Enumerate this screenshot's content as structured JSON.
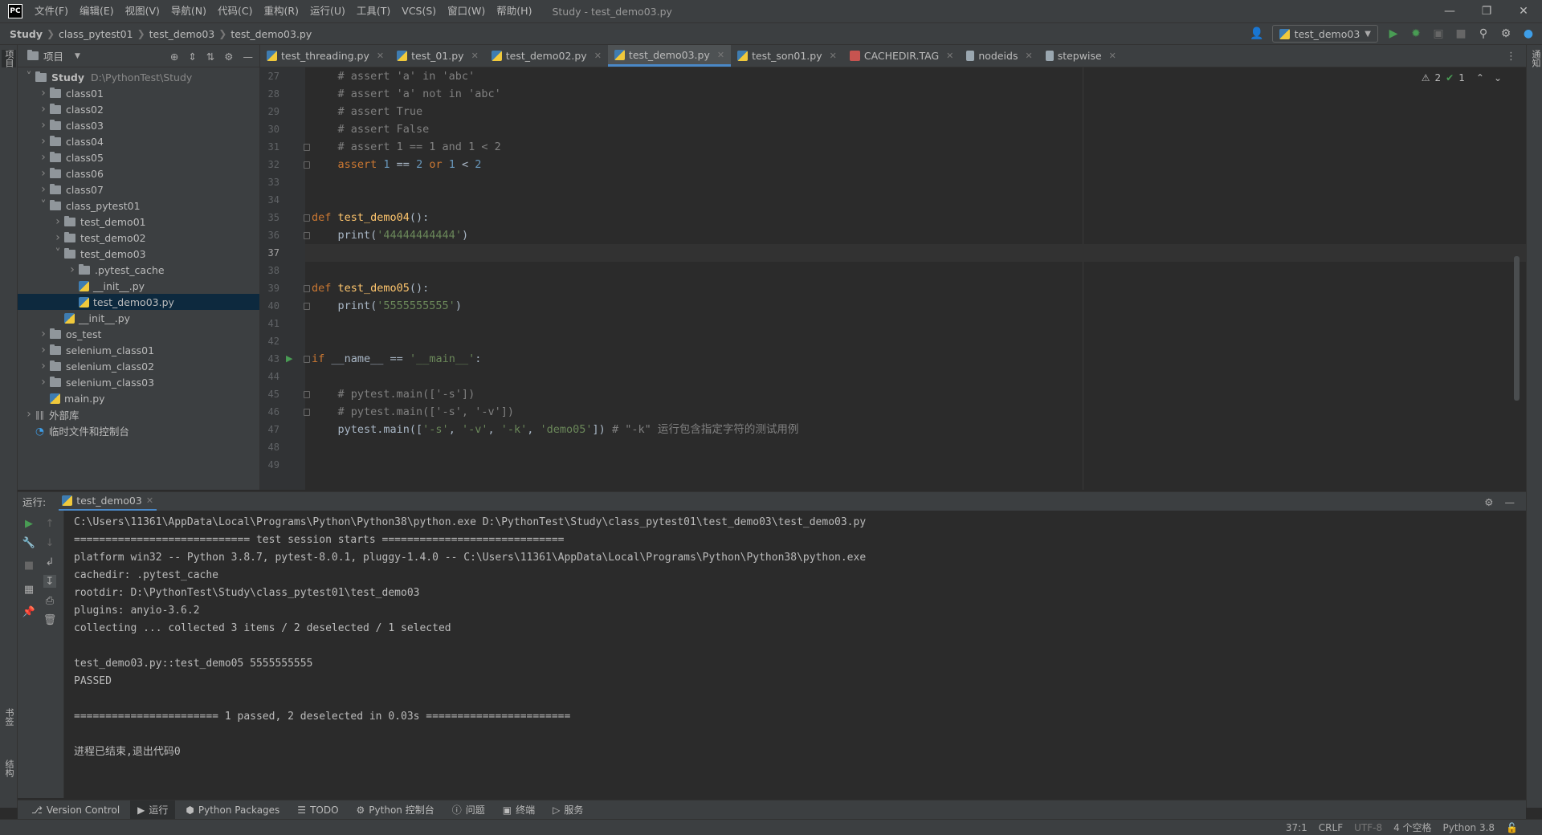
{
  "app": {
    "logo": "PC",
    "window_title": "Study - test_demo03.py",
    "menu": [
      "文件(F)",
      "编辑(E)",
      "视图(V)",
      "导航(N)",
      "代码(C)",
      "重构(R)",
      "运行(U)",
      "工具(T)",
      "VCS(S)",
      "窗口(W)",
      "帮助(H)"
    ]
  },
  "breadcrumb": [
    "Study",
    "class_pytest01",
    "test_demo03",
    "test_demo03.py"
  ],
  "toolbar": {
    "run_config": "test_demo03"
  },
  "left_strip": {
    "project_tab": "项目",
    "bookmarks_tab": "书签",
    "structure_tab": "结构"
  },
  "right_strip": {
    "notifications_tab": "通知"
  },
  "project_panel": {
    "title": "项目",
    "tree": [
      {
        "label": "Study",
        "hint": "D:\\PythonTest\\Study",
        "indent": 0,
        "expanded": true,
        "kind": "folder",
        "bold": true
      },
      {
        "label": "class01",
        "indent": 1,
        "expanded": false,
        "kind": "folder"
      },
      {
        "label": "class02",
        "indent": 1,
        "expanded": false,
        "kind": "folder"
      },
      {
        "label": "class03",
        "indent": 1,
        "expanded": false,
        "kind": "folder"
      },
      {
        "label": "class04",
        "indent": 1,
        "expanded": false,
        "kind": "folder"
      },
      {
        "label": "class05",
        "indent": 1,
        "expanded": false,
        "kind": "folder"
      },
      {
        "label": "class06",
        "indent": 1,
        "expanded": false,
        "kind": "folder"
      },
      {
        "label": "class07",
        "indent": 1,
        "expanded": false,
        "kind": "folder"
      },
      {
        "label": "class_pytest01",
        "indent": 1,
        "expanded": true,
        "kind": "folder"
      },
      {
        "label": "test_demo01",
        "indent": 2,
        "expanded": false,
        "kind": "folder"
      },
      {
        "label": "test_demo02",
        "indent": 2,
        "expanded": false,
        "kind": "folder"
      },
      {
        "label": "test_demo03",
        "indent": 2,
        "expanded": true,
        "kind": "folder"
      },
      {
        "label": ".pytest_cache",
        "indent": 3,
        "expanded": false,
        "kind": "folder"
      },
      {
        "label": "__init__.py",
        "indent": 3,
        "kind": "py"
      },
      {
        "label": "test_demo03.py",
        "indent": 3,
        "kind": "py",
        "selected": true
      },
      {
        "label": "__init__.py",
        "indent": 2,
        "kind": "py"
      },
      {
        "label": "os_test",
        "indent": 1,
        "expanded": false,
        "kind": "folder"
      },
      {
        "label": "selenium_class01",
        "indent": 1,
        "expanded": false,
        "kind": "folder"
      },
      {
        "label": "selenium_class02",
        "indent": 1,
        "expanded": false,
        "kind": "folder"
      },
      {
        "label": "selenium_class03",
        "indent": 1,
        "expanded": false,
        "kind": "folder"
      },
      {
        "label": "main.py",
        "indent": 1,
        "kind": "py"
      },
      {
        "label": "外部库",
        "indent": 0,
        "expanded": false,
        "kind": "lib"
      },
      {
        "label": "临时文件和控制台",
        "indent": 0,
        "kind": "scratch"
      }
    ]
  },
  "editor_tabs": [
    {
      "label": "test_threading.py",
      "icon": "py"
    },
    {
      "label": "test_01.py",
      "icon": "py"
    },
    {
      "label": "test_demo02.py",
      "icon": "py"
    },
    {
      "label": "test_demo03.py",
      "icon": "py",
      "active": true
    },
    {
      "label": "test_son01.py",
      "icon": "py"
    },
    {
      "label": "CACHEDIR.TAG",
      "icon": "tag"
    },
    {
      "label": "nodeids",
      "icon": "doc"
    },
    {
      "label": "stepwise",
      "icon": "doc"
    }
  ],
  "editor": {
    "warnings": "2",
    "checks": "1",
    "current_line": 37,
    "lines": [
      {
        "no": "27",
        "tokens": [
          [
            "cmt",
            "    # assert 'a' in 'abc'"
          ]
        ]
      },
      {
        "no": "28",
        "tokens": [
          [
            "cmt",
            "    # assert 'a' not in 'abc'"
          ]
        ]
      },
      {
        "no": "29",
        "tokens": [
          [
            "cmt",
            "    # assert True"
          ]
        ]
      },
      {
        "no": "30",
        "tokens": [
          [
            "cmt",
            "    # assert False"
          ]
        ]
      },
      {
        "no": "31",
        "tokens": [
          [
            "cmt",
            "    # assert 1 == 1 and 1 < 2"
          ]
        ],
        "fold": true
      },
      {
        "no": "32",
        "tokens": [
          [
            "kw",
            "    assert "
          ],
          [
            "num",
            "1"
          ],
          [
            "",
            " == "
          ],
          [
            "num",
            "2"
          ],
          [
            "kw",
            " or "
          ],
          [
            "num",
            "1"
          ],
          [
            "",
            " < "
          ],
          [
            "num",
            "2"
          ]
        ],
        "fold": true
      },
      {
        "no": "33",
        "tokens": []
      },
      {
        "no": "34",
        "tokens": []
      },
      {
        "no": "35",
        "tokens": [
          [
            "kw",
            "def "
          ],
          [
            "fn",
            "test_demo04"
          ],
          [
            "",
            "():"
          ]
        ],
        "fold": true
      },
      {
        "no": "36",
        "tokens": [
          [
            "",
            "    print("
          ],
          [
            "str",
            "'44444444444'"
          ],
          [
            "",
            ")"
          ]
        ],
        "fold": true
      },
      {
        "no": "37",
        "tokens": []
      },
      {
        "no": "38",
        "tokens": []
      },
      {
        "no": "39",
        "tokens": [
          [
            "kw",
            "def "
          ],
          [
            "fn",
            "test_demo05"
          ],
          [
            "",
            "():"
          ]
        ],
        "fold": true
      },
      {
        "no": "40",
        "tokens": [
          [
            "",
            "    print("
          ],
          [
            "str",
            "'5555555555'"
          ],
          [
            "",
            ")"
          ]
        ],
        "fold": true
      },
      {
        "no": "41",
        "tokens": []
      },
      {
        "no": "42",
        "tokens": []
      },
      {
        "no": "43",
        "tokens": [
          [
            "kw",
            "if "
          ],
          [
            "",
            "__name__ == "
          ],
          [
            "str",
            "'__main__'"
          ],
          [
            "",
            ":"
          ]
        ],
        "fold": true,
        "run": true
      },
      {
        "no": "44",
        "tokens": []
      },
      {
        "no": "45",
        "tokens": [
          [
            "cmt",
            "    # pytest.main(['-s'])"
          ]
        ],
        "fold": true
      },
      {
        "no": "46",
        "tokens": [
          [
            "cmt",
            "    # pytest.main(['-s', '-v'])"
          ]
        ],
        "fold": true
      },
      {
        "no": "47",
        "tokens": [
          [
            "",
            "    pytest.main(["
          ],
          [
            "str",
            "'-s'"
          ],
          [
            "",
            ", "
          ],
          [
            "str",
            "'-v'"
          ],
          [
            "",
            ", "
          ],
          [
            "str",
            "'-k'"
          ],
          [
            "",
            ", "
          ],
          [
            "str",
            "'demo05'"
          ],
          [
            "",
            "]) "
          ],
          [
            "cmt",
            "# \"-k\" 运行包含指定字符的测试用例"
          ]
        ]
      },
      {
        "no": "48",
        "tokens": []
      },
      {
        "no": "49",
        "tokens": []
      }
    ]
  },
  "run_panel": {
    "label": "运行:",
    "tab": "test_demo03",
    "console": [
      "C:\\Users\\11361\\AppData\\Local\\Programs\\Python\\Python38\\python.exe D:\\PythonTest\\Study\\class_pytest01\\test_demo03\\test_demo03.py",
      "============================ test session starts =============================",
      "platform win32 -- Python 3.8.7, pytest-8.0.1, pluggy-1.4.0 -- C:\\Users\\11361\\AppData\\Local\\Programs\\Python\\Python38\\python.exe",
      "cachedir: .pytest_cache",
      "rootdir: D:\\PythonTest\\Study\\class_pytest01\\test_demo03",
      "plugins: anyio-3.6.2",
      "collecting ... collected 3 items / 2 deselected / 1 selected",
      "",
      "test_demo03.py::test_demo05 5555555555",
      "PASSED",
      "",
      "======================= 1 passed, 2 deselected in 0.03s =======================",
      "",
      "进程已结束,退出代码0"
    ]
  },
  "bottom_tools": [
    {
      "label": "Version Control",
      "icon": "branch-icon"
    },
    {
      "label": "运行",
      "icon": "play-icon",
      "active": true
    },
    {
      "label": "Python Packages",
      "icon": "package-icon"
    },
    {
      "label": "TODO",
      "icon": "list-icon"
    },
    {
      "label": "Python 控制台",
      "icon": "python-console-icon"
    },
    {
      "label": "问题",
      "icon": "info-icon"
    },
    {
      "label": "终端",
      "icon": "terminal-icon"
    },
    {
      "label": "服务",
      "icon": "services-icon"
    }
  ],
  "status_bar": {
    "position": "37:1",
    "line_sep": "CRLF",
    "encoding": "UTF-8",
    "indent": "4 个空格",
    "interpreter": "Python 3.8"
  },
  "colors": {
    "accent": "#4a88c7",
    "keyword": "#cc7832",
    "function": "#ffc66d",
    "string": "#6a8759",
    "number": "#6897bb",
    "comment": "#808080",
    "run_green": "#499c54"
  }
}
